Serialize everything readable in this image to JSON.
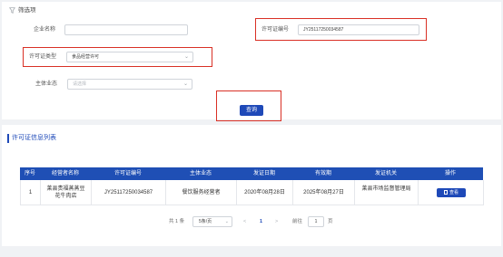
{
  "filter": {
    "title": "筛选项",
    "company_label": "企业名称",
    "company_value": "",
    "license_no_label": "许可证编号",
    "license_no_value": "JY25117250034587",
    "license_type_label": "许可证类型",
    "license_type_value": "食品经营许可",
    "business_label": "主体业态",
    "business_placeholder": "请选择",
    "query_button": "查询"
  },
  "list": {
    "title": "许可证信息列表",
    "headers": [
      "序号",
      "经营者名称",
      "许可证编号",
      "主体业态",
      "发证日期",
      "有效期",
      "发证机关",
      "操作"
    ],
    "rows": [
      {
        "index": "1",
        "name": "莱县贵福蒸蒸豆花牛肉店",
        "license_no": "JY25117250034587",
        "business": "餐饮服务经营者",
        "issue_date": "2020年08月28日",
        "valid_until": "2025年08月27日",
        "authority": "莱县市场监督管理局",
        "action": "查看"
      }
    ]
  },
  "pagination": {
    "total": "共 1 条",
    "page_size": "5条/页",
    "current_page": "1",
    "goto_label": "前往",
    "goto_value": "1",
    "page_unit": "页"
  },
  "colors": {
    "primary": "#1e49b8",
    "header": "#1f4fb5",
    "highlight": "#d93025"
  }
}
